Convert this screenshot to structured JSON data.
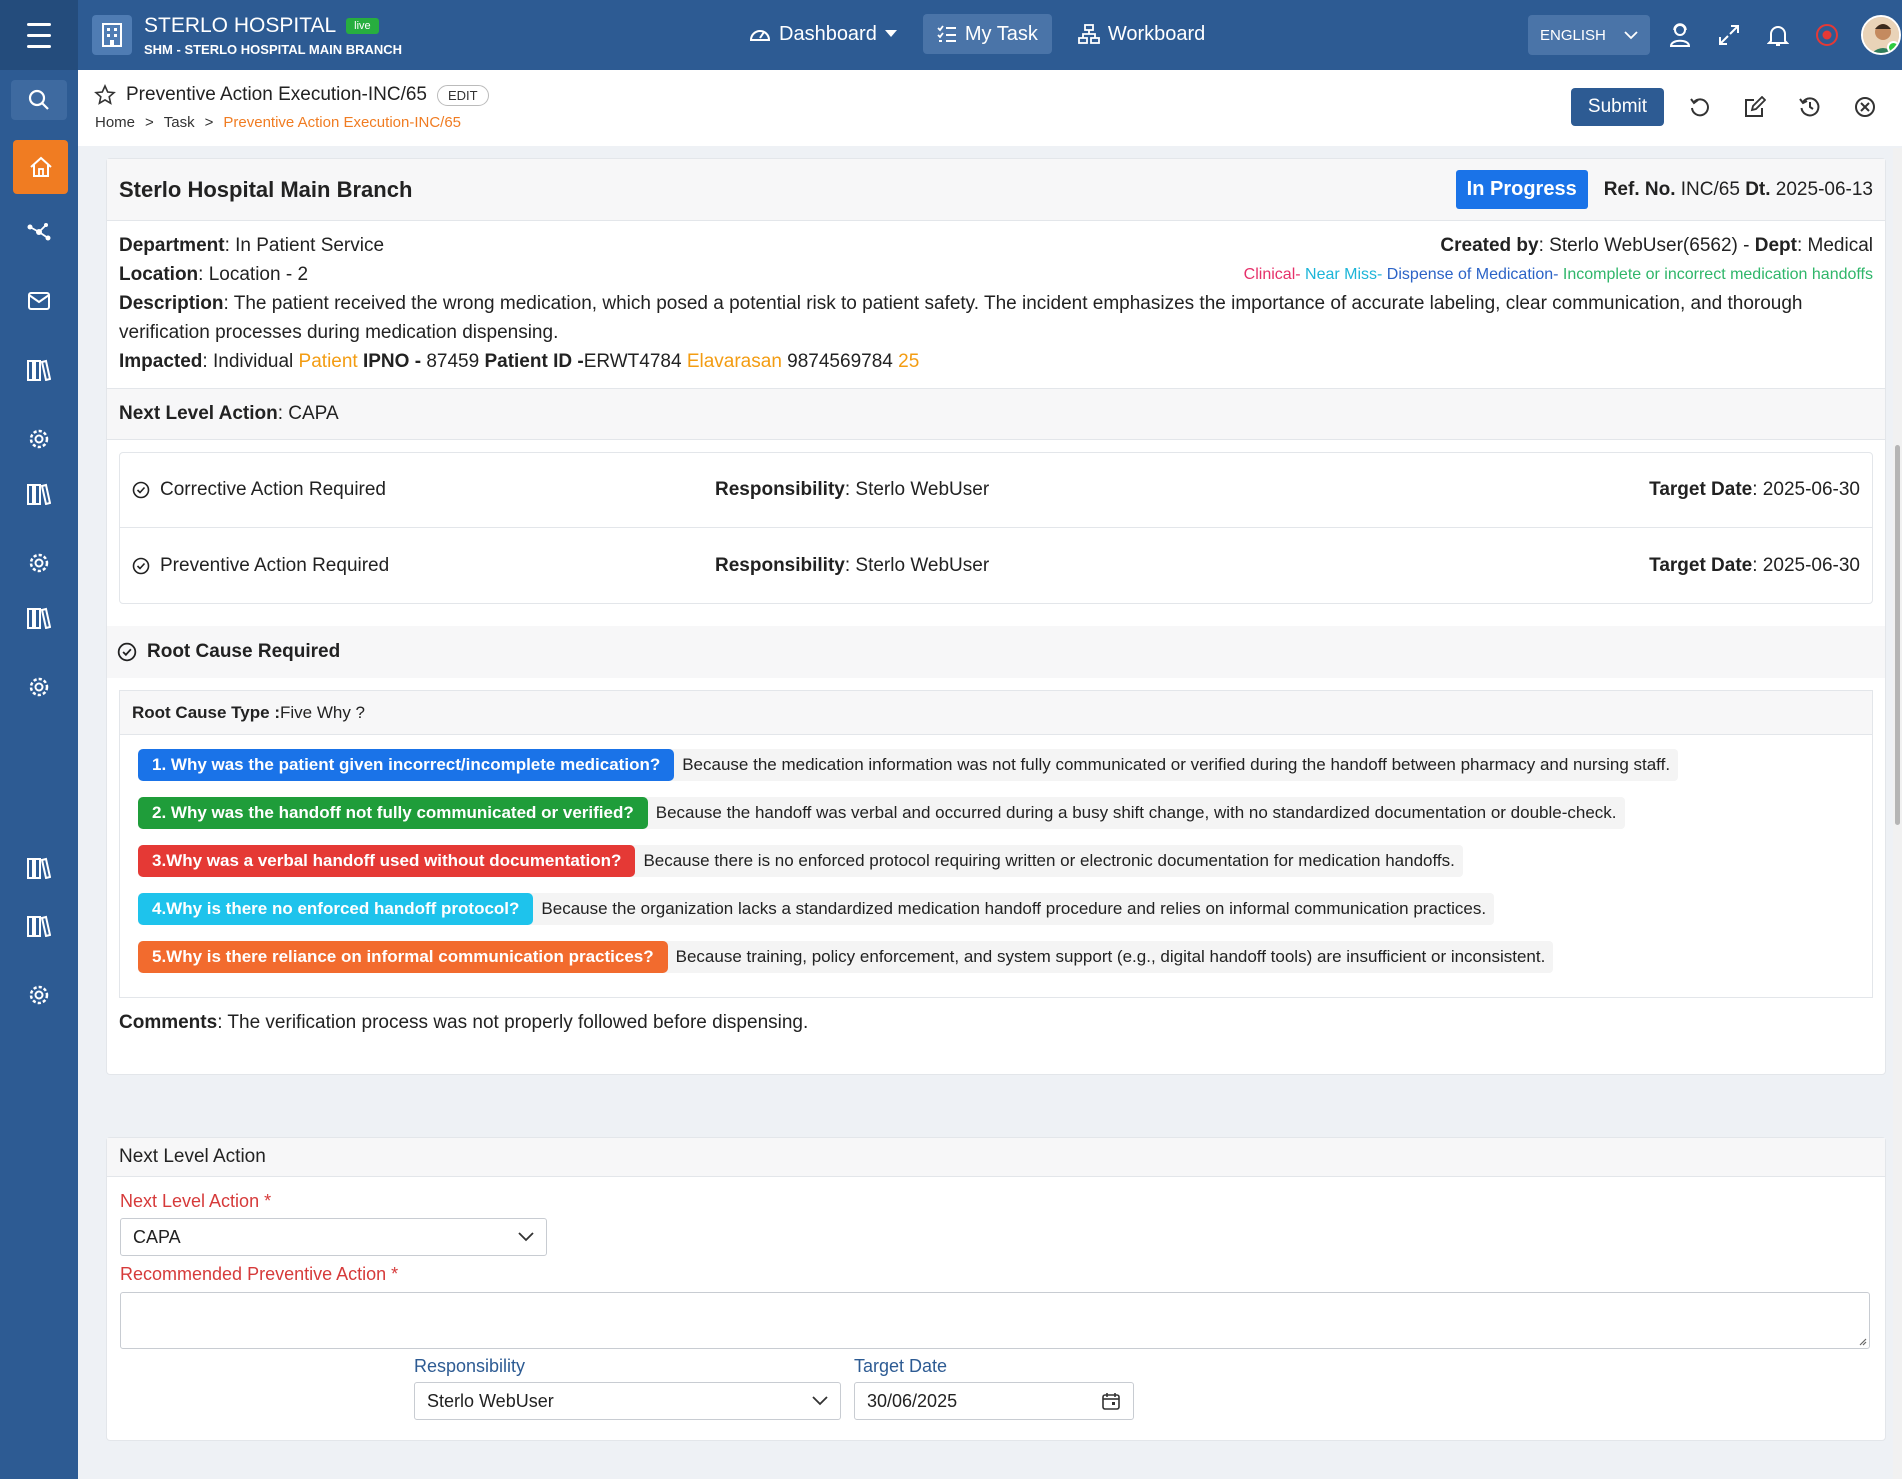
{
  "app": {
    "title": "STERLO HOSPITAL",
    "live_badge": "live",
    "subtitle": "SHM - STERLO HOSPITAL MAIN BRANCH"
  },
  "nav": {
    "dashboard": "Dashboard",
    "my_task": "My Task",
    "workboard": "Workboard",
    "language": "ENGLISH"
  },
  "page": {
    "title": "Preventive Action Execution-INC/65",
    "edit_badge": "EDIT",
    "breadcrumb": [
      "Home",
      ">",
      "Task",
      ">",
      "Preventive Action Execution-INC/65"
    ],
    "submit_label": "Submit"
  },
  "incident": {
    "branch": "Sterlo Hospital Main Branch",
    "status": "In Progress",
    "ref_label": "Ref. No.",
    "ref_no": "INC/65",
    "dt_label": "Dt.",
    "date": "2025-06-13",
    "department_label": "Department",
    "department": ": In Patient Service",
    "created_by_label": "Created by",
    "created_by": ": Sterlo WebUser(6562) - ",
    "dept_label": "Dept",
    "dept": ": Medical",
    "location_label": "Location",
    "location": ": Location - 2",
    "tags": [
      "Clinical-",
      " Near Miss-",
      " Dispense of Medication-",
      " Incomplete or incorrect medication handoffs"
    ],
    "description_label": "Description",
    "description": ": The patient received the wrong medication, which posed a potential risk to patient safety. The incident emphasizes the importance of accurate labeling, clear communication, and thorough verification processes during medication dispensing.",
    "impacted_label": "Impacted",
    "impacted_type": ": Individual ",
    "impacted_role": "Patient",
    "ipno_label": " IPNO - ",
    "ipno": "87459",
    "patient_id_label": " Patient ID -",
    "patient_id": "ERWT4784",
    "patient_name": " Elavarasan",
    "phone": " 9874569784",
    "age": " 25"
  },
  "next_level": {
    "label": "Next Level Action",
    "value": ": CAPA",
    "actions": [
      {
        "name": "Corrective Action Required",
        "resp_label": "Responsibility",
        "resp": ": Sterlo WebUser",
        "date_label": "Target Date",
        "date": ": 2025-06-30"
      },
      {
        "name": "Preventive Action Required",
        "resp_label": "Responsibility",
        "resp": ": Sterlo WebUser",
        "date_label": "Target Date",
        "date": ": 2025-06-30"
      }
    ]
  },
  "root_cause": {
    "heading": "Root Cause Required",
    "type_label": "Root Cause Type :",
    "type": " Five Why ?",
    "whys": [
      {
        "q": "1. Why was the patient given incorrect/incomplete medication?",
        "a": "Because the medication information was not fully communicated or verified during the handoff between pharmacy and nursing staff.",
        "color": "#1a73e8"
      },
      {
        "q": "2. Why was the handoff not fully communicated or verified?",
        "a": "Because the handoff was verbal and occurred during a busy shift change, with no standardized documentation or double-check.",
        "color": "#1f9d3a"
      },
      {
        "q": "3.Why was a verbal handoff used without documentation?",
        "a": "Because there is no enforced protocol requiring written or electronic documentation for medication handoffs.",
        "color": "#e53935"
      },
      {
        "q": "4.Why is there no enforced handoff protocol?",
        "a": "Because the organization lacks a standardized medication handoff procedure and relies on informal communication practices.",
        "color": "#1ec3ec"
      },
      {
        "q": "5.Why is there reliance on informal communication practices?",
        "a": "Because training, policy enforcement, and system support (e.g., digital handoff tools) are insufficient or inconsistent.",
        "color": "#f26b2e"
      }
    ],
    "comments_label": "Comments",
    "comments": ": The verification process was not properly followed before dispensing."
  },
  "form": {
    "heading": "Next Level Action",
    "next_level_label": "Next Level Action *",
    "next_level_value": "CAPA",
    "recommended_label": "Recommended Preventive Action *",
    "recommended_value": "",
    "responsibility_label": "Responsibility",
    "responsibility_value": "Sterlo WebUser",
    "target_date_label": "Target Date",
    "target_date_value": "30/06/2025"
  }
}
